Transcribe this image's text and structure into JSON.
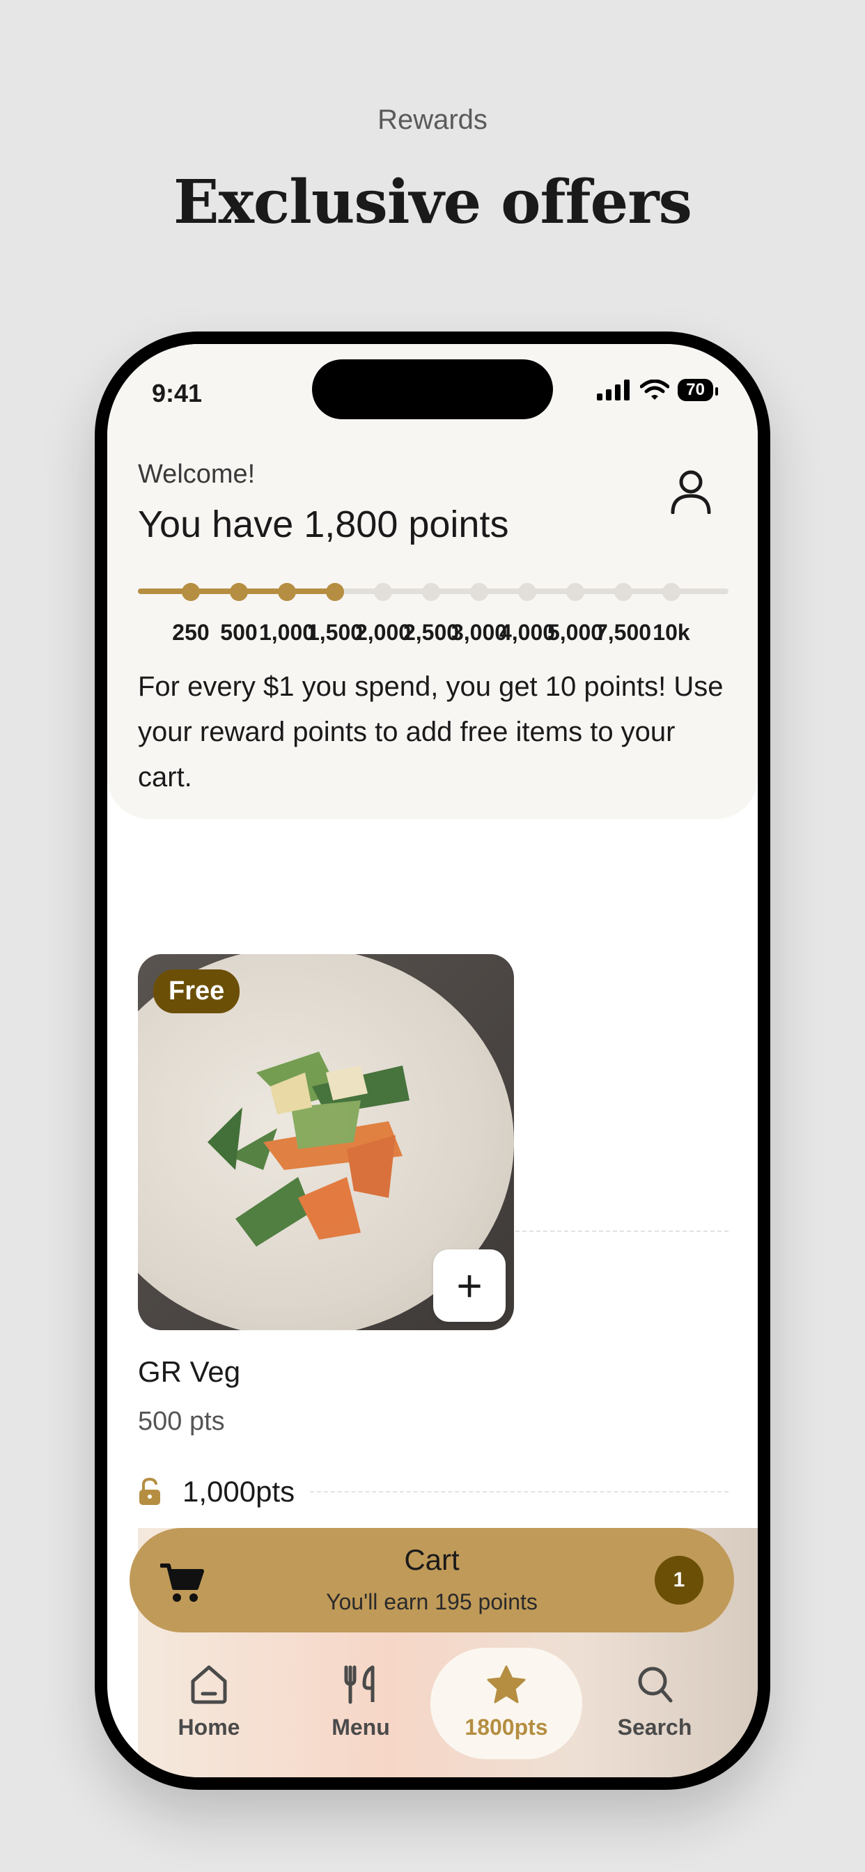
{
  "page": {
    "eyebrow": "Rewards",
    "headline": "Exclusive offers"
  },
  "status_bar": {
    "time": "9:41",
    "battery": "70"
  },
  "header": {
    "welcome": "Welcome!",
    "points_title": "You have 1,800 points",
    "progress": {
      "current_points": 1800,
      "tiers": [
        "250",
        "500",
        "1,000",
        "1,500",
        "2,000",
        "2,500",
        "3,000",
        "4,000",
        "5,000",
        "7,500",
        "10k"
      ],
      "reached_count": 4
    },
    "blurb": "For every $1 you spend, you get 10 points! Use your reward points to add free items to your cart."
  },
  "sections": [
    {
      "label": "500pts",
      "items": [
        {
          "badge": "Free",
          "name": "GR Veg",
          "points": "500 pts",
          "add_label": "+"
        }
      ]
    },
    {
      "label": "1,000pts"
    }
  ],
  "cart": {
    "title": "Cart",
    "subtitle": "You'll earn 195 points",
    "count": "1"
  },
  "tabbar": {
    "items": [
      {
        "label": "Home",
        "icon": "home-icon"
      },
      {
        "label": "Menu",
        "icon": "fork-knife-icon"
      },
      {
        "label": "1800pts",
        "icon": "star-icon"
      },
      {
        "label": "Search",
        "icon": "search-icon"
      }
    ],
    "active_index": 2
  },
  "colors": {
    "accent": "#b58e42",
    "cart_bar": "#c09a58",
    "badge": "#6c4f07",
    "background": "#e6e6e6"
  }
}
